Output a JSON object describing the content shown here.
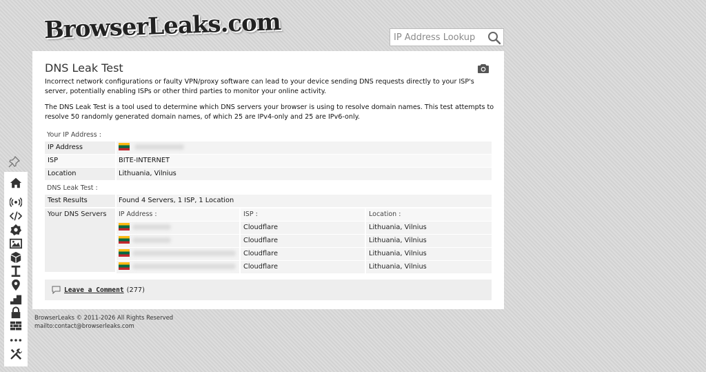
{
  "brand": {
    "logo_text": "BrowserLeaks.com"
  },
  "search": {
    "placeholder": "IP Address Lookup"
  },
  "page": {
    "title": "DNS Leak Test",
    "intro_1": "Incorrect network configurations or faulty VPN/proxy software can lead to your device sending DNS requests directly to your ISP's server, potentially enabling ISPs or other third parties to monitor your online activity.",
    "intro_2": "The DNS Leak Test is a tool used to determine which DNS servers your browser is using to resolve domain names. This test attempts to resolve 50 randomly generated domain names, of which 25 are IPv4-only and 25 are IPv6-only."
  },
  "ip_section": {
    "label": "Your IP Address :",
    "rows": [
      {
        "key": "IP Address",
        "value": ""
      },
      {
        "key": "ISP",
        "value": "BITE-INTERNET"
      },
      {
        "key": "Location",
        "value": "Lithuania, Vilnius"
      }
    ]
  },
  "dns_section": {
    "label": "DNS Leak Test :",
    "results_key": "Test Results",
    "results_value": "Found 4 Servers, 1 ISP, 1 Location",
    "servers_key": "Your DNS Servers",
    "columns": [
      "IP Address :",
      "ISP :",
      "Location :"
    ],
    "servers": [
      {
        "isp": "Cloudflare",
        "location": "Lithuania, Vilnius"
      },
      {
        "isp": "Cloudflare",
        "location": "Lithuania, Vilnius"
      },
      {
        "isp": "Cloudflare",
        "location": "Lithuania, Vilnius"
      },
      {
        "isp": "Cloudflare",
        "location": "Lithuania, Vilnius"
      }
    ]
  },
  "comments": {
    "link_label": "Leave a Comment",
    "count": "(277)"
  },
  "footer": {
    "copyright": "BrowserLeaks © 2011-2026 All Rights Reserved",
    "contact": "mailto:contact@browserleaks.com"
  },
  "toolbar_icons": [
    "home-icon",
    "broadcast-icon",
    "code-icon",
    "gear-flower-icon",
    "image-icon",
    "cube-icon",
    "text-cursor-icon",
    "location-pin-icon",
    "stairs-icon",
    "lock-icon",
    "brick-wall-icon",
    "more-dots-icon",
    "tools-icon"
  ],
  "colors": {
    "lithuania_flag": [
      "#fdb913",
      "#006a44",
      "#c1272d"
    ]
  }
}
